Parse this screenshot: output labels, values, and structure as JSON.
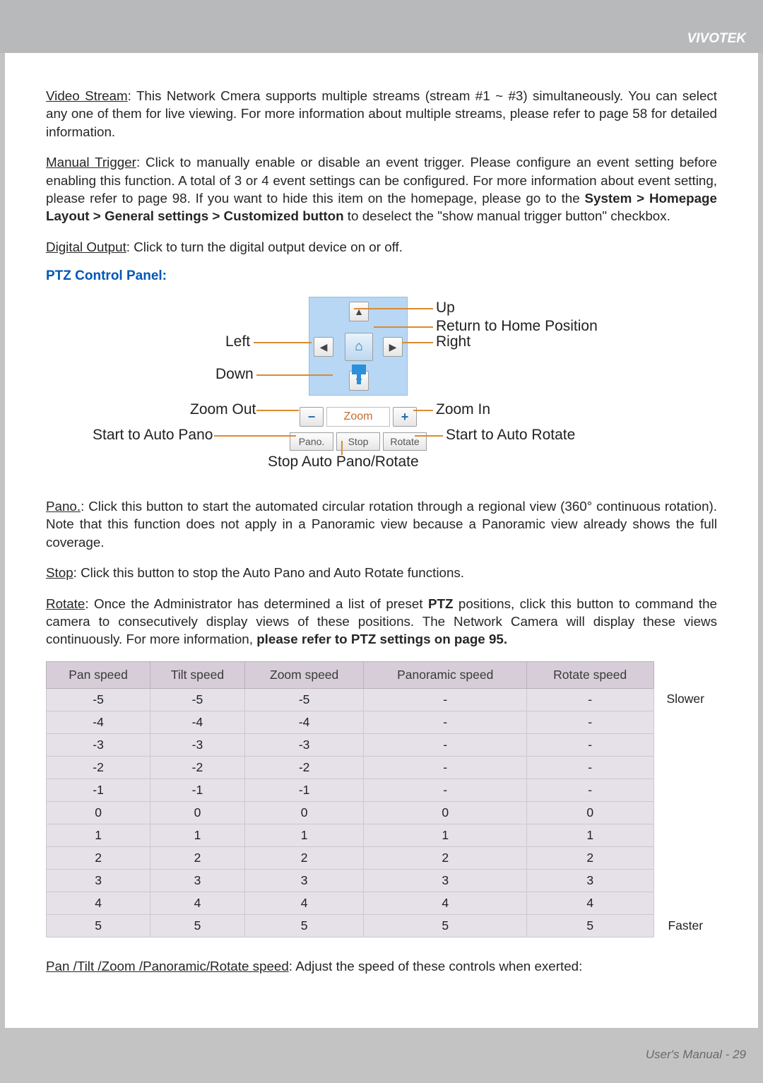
{
  "brand": "VIVOTEK",
  "footer": "User's Manual - 29",
  "paragraphs": {
    "video_stream_label": "Video Stream",
    "video_stream_text": ": This Network Cmera supports multiple streams (stream #1 ~ #3) simultaneously. You can select any one of them for live viewing. For more information about multiple streams, please refer to page 58 for detailed information.",
    "manual_trigger_label": "Manual Trigger",
    "manual_trigger_text_a": ": Click to manually enable or disable an event trigger. Please configure an event setting before enabling this function. A total of 3 or 4 event settings can be configured. For more information about event setting, please refer to page 98. If you want to hide this item on the homepage, please go to the ",
    "manual_trigger_bold": "System > Homepage Layout > General settings > Customized button",
    "manual_trigger_text_b": " to deselect the \"show manual trigger button\" checkbox.",
    "digital_output_label": "Digital Output",
    "digital_output_text": ": Click to turn the digital output device on or off.",
    "pano_label": "Pano.",
    "pano_text": ": Click this button to start the automated circular rotation through a regional view (360° continuous rotation). Note that this function does not apply in a Panoramic view because a Panoramic view already shows the full coverage.",
    "stop_label": "Stop",
    "stop_text": ": Click this button to stop the Auto Pano and Auto Rotate functions.",
    "rotate_label": "Rotate",
    "rotate_text_a": ": Once the Administrator has determined a list of preset ",
    "rotate_bold_ptz": "PTZ",
    "rotate_text_b": " positions, click this button to command the camera to consecutively display views of these positions. The Network Camera will display these views continuously. For more information, ",
    "rotate_bold_ref": "please refer to PTZ settings on page 95.",
    "speed_label": "Pan /Tilt /Zoom /Panoramic/Rotate speed",
    "speed_text": ": Adjust the speed of these controls when exerted:"
  },
  "ptz": {
    "section_title": "PTZ Control Panel:",
    "zoom_label": "Zoom",
    "pano_btn": "Pano.",
    "stop_btn": "Stop",
    "rotate_btn": "Rotate",
    "callouts": {
      "up": "Up",
      "home": "Return to Home Position",
      "left": "Left",
      "right": "Right",
      "down": "Down",
      "zoom_out": "Zoom Out",
      "zoom_in": "Zoom In",
      "auto_pano": "Start to Auto Pano",
      "auto_rotate": "Start to Auto Rotate",
      "stop_auto": "Stop Auto Pano/Rotate"
    }
  },
  "table": {
    "headers": [
      "Pan speed",
      "Tilt speed",
      "Zoom speed",
      "Panoramic speed",
      "Rotate speed"
    ],
    "slower": "Slower",
    "faster": "Faster",
    "rows": [
      [
        "-5",
        "-5",
        "-5",
        "-",
        "-"
      ],
      [
        "-4",
        "-4",
        "-4",
        "-",
        "-"
      ],
      [
        "-3",
        "-3",
        "-3",
        "-",
        "-"
      ],
      [
        "-2",
        "-2",
        "-2",
        "-",
        "-"
      ],
      [
        "-1",
        "-1",
        "-1",
        "-",
        "-"
      ],
      [
        "0",
        "0",
        "0",
        "0",
        "0"
      ],
      [
        "1",
        "1",
        "1",
        "1",
        "1"
      ],
      [
        "2",
        "2",
        "2",
        "2",
        "2"
      ],
      [
        "3",
        "3",
        "3",
        "3",
        "3"
      ],
      [
        "4",
        "4",
        "4",
        "4",
        "4"
      ],
      [
        "5",
        "5",
        "5",
        "5",
        "5"
      ]
    ]
  }
}
